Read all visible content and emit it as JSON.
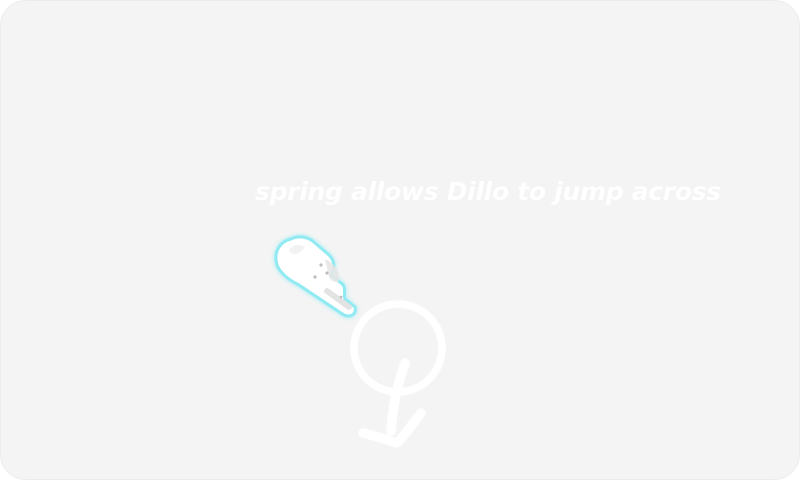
{
  "tutorial": {
    "hint_text": "spring allows Dillo to jump across"
  },
  "icons": {
    "hand": "tap-hand-icon",
    "gesture": "circle-swipe-down-gesture-icon"
  },
  "colors": {
    "background": "#f4f4f4",
    "hint_text": "#ffffff",
    "hand_glow": "#7fe8f0"
  }
}
